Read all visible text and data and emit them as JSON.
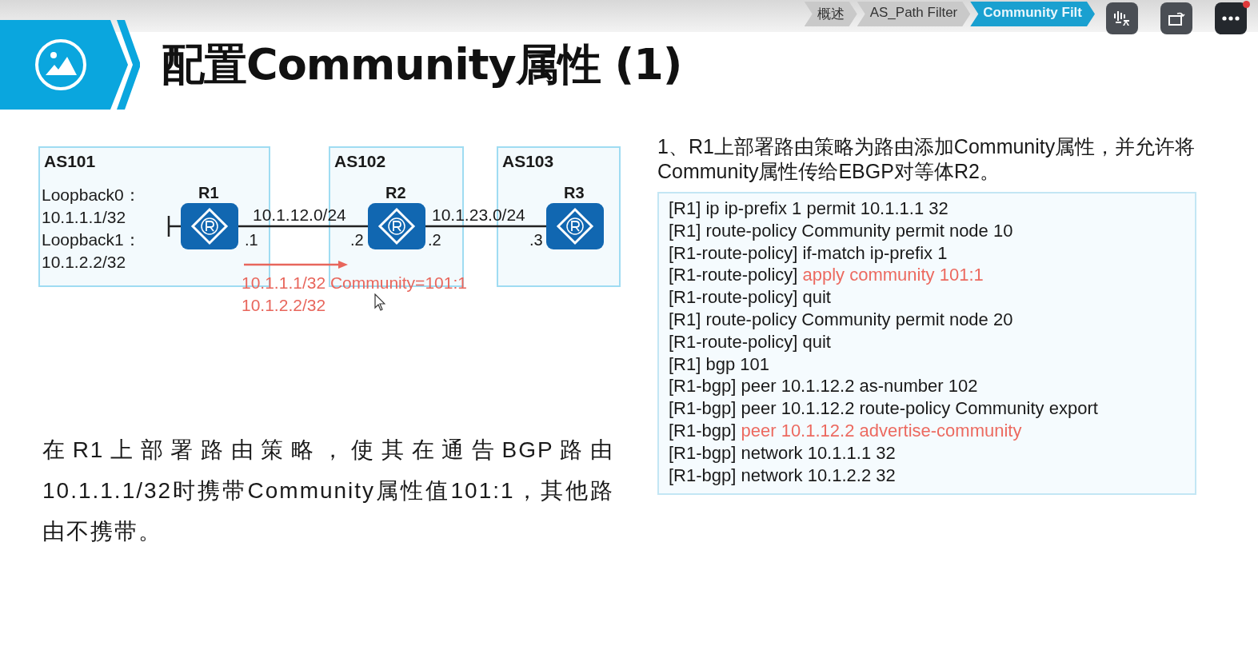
{
  "breadcrumb": [
    {
      "label": "概述",
      "selected": false
    },
    {
      "label": "AS_Path Filter",
      "selected": false
    },
    {
      "label": "Community Filt",
      "selected": true
    }
  ],
  "title": "配置Community属性 (1)",
  "diagram": {
    "as_boxes": [
      {
        "label": "AS101"
      },
      {
        "label": "AS102"
      },
      {
        "label": "AS103"
      }
    ],
    "routers": [
      {
        "label": "R1"
      },
      {
        "label": "R2"
      },
      {
        "label": "R3"
      }
    ],
    "loopbacks": [
      "Loopback0：",
      "10.1.1.1/32",
      "Loopback1：",
      "10.1.2.2/32"
    ],
    "links": [
      {
        "subnet": "10.1.12.0/24",
        "left_end": ".1",
        "right_end": ".2"
      },
      {
        "subnet": "10.1.23.0/24",
        "left_end": ".2",
        "right_end": ".3"
      }
    ],
    "advertised": [
      "10.1.1.1/32 Community=101:1",
      "10.1.2.2/32"
    ]
  },
  "task": "在R1上部署路由策略，使其在通告BGP路由10.1.1.1/32时携带Community属性值101:1，其他路由不携带。",
  "step": "1、R1上部署路由策略为路由添加Community属性，并允许将Community属性传给EBGP对等体R2。",
  "config": [
    {
      "prompt": "[R1]",
      "command": "ip ip-prefix 1 permit 10.1.1.1 32",
      "highlight": false
    },
    {
      "prompt": "[R1]",
      "command": "route-policy Community permit node 10",
      "highlight": false
    },
    {
      "prompt": "[R1-route-policy]",
      "command": "if-match ip-prefix 1",
      "highlight": false
    },
    {
      "prompt": "[R1-route-policy]",
      "command": "apply community 101:1",
      "highlight": true
    },
    {
      "prompt": "[R1-route-policy]",
      "command": "quit",
      "highlight": false
    },
    {
      "prompt": "[R1]",
      "command": "route-policy Community permit node 20",
      "highlight": false
    },
    {
      "prompt": "[R1-route-policy]",
      "command": "quit",
      "highlight": false
    },
    {
      "prompt": "[R1]",
      "command": "bgp 101",
      "highlight": false
    },
    {
      "prompt": "[R1-bgp]",
      "command": "peer 10.1.12.2 as-number 102",
      "highlight": false
    },
    {
      "prompt": "[R1-bgp]",
      "command": "peer 10.1.12.2 route-policy Community export",
      "highlight": false
    },
    {
      "prompt": "[R1-bgp]",
      "command": "peer 10.1.12.2 advertise-community",
      "highlight": true
    },
    {
      "prompt": "[R1-bgp]",
      "command": "network 10.1.1.1 32",
      "highlight": false
    },
    {
      "prompt": "[R1-bgp]",
      "command": "network 10.1.2.2 32",
      "highlight": false
    }
  ]
}
